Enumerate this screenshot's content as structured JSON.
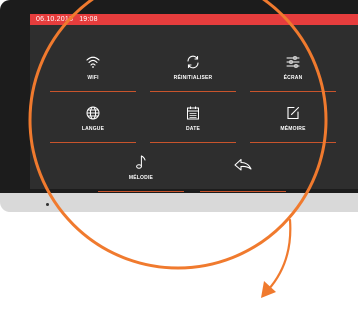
{
  "status_bar": {
    "date": "06.10.2018",
    "time": "19:08"
  },
  "menu": {
    "wifi": {
      "label": "WIFI",
      "icon": "wifi-icon"
    },
    "reset": {
      "label": "RÉINITIALISER",
      "icon": "refresh-icon"
    },
    "screen": {
      "label": "ÉCRAN",
      "icon": "sliders-icon"
    },
    "language": {
      "label": "LANGUE",
      "icon": "globe-icon"
    },
    "date": {
      "label": "DATE",
      "icon": "calendar-icon"
    },
    "memory": {
      "label": "MÉMOIRE",
      "icon": "edit-icon"
    },
    "melody": {
      "label": "MÉLODIE",
      "icon": "music-note-icon"
    },
    "back": {
      "label": "",
      "icon": "back-arrow-icon"
    }
  },
  "colors": {
    "status_bar": "#e63d3d",
    "screen_bg": "#2e2e2e",
    "accent_orange": "#f07a2e",
    "underline": "#c9542c"
  }
}
